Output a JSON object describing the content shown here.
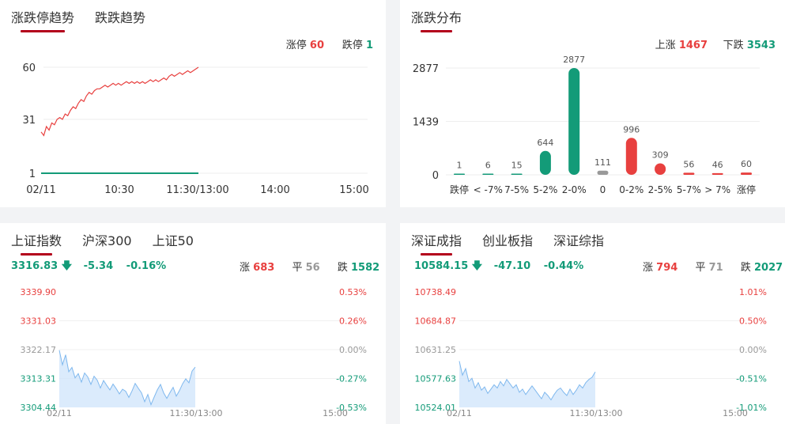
{
  "panel1": {
    "tabs": [
      "涨跌停趋势",
      "跌跌趋势"
    ],
    "limit_up_label": "涨停",
    "limit_up_value": "60",
    "limit_down_label": "跌停",
    "limit_down_value": "1"
  },
  "panel2": {
    "tabs": [
      "涨跌分布"
    ],
    "up_label": "上涨",
    "up_value": "1467",
    "down_label": "下跌",
    "down_value": "3543"
  },
  "panel3": {
    "tabs": [
      "上证指数",
      "沪深300",
      "上证50"
    ],
    "price": "3316.83",
    "change": "-5.34",
    "change_pct": "-0.16%",
    "up_label": "涨",
    "up_count": "683",
    "flat_label": "平",
    "flat_count": "56",
    "down_label": "跌",
    "down_count": "1582"
  },
  "panel4": {
    "tabs": [
      "深证成指",
      "创业板指",
      "深证综指"
    ],
    "price": "10584.15",
    "change": "-47.10",
    "change_pct": "-0.44%",
    "up_label": "涨",
    "up_count": "794",
    "flat_label": "平",
    "flat_count": "71",
    "down_label": "跌",
    "down_count": "2027"
  },
  "colors": {
    "up": "#e8403f",
    "down": "#139b78",
    "flat": "#999999",
    "accent": "#b3001b",
    "area": "#cfe4fb"
  },
  "chart_data": [
    {
      "type": "line",
      "ylim": [
        1,
        60
      ],
      "yticks": [
        "60",
        "31",
        "1"
      ],
      "xticks": [
        "02/11",
        "10:30",
        "11:30/13:00",
        "14:00",
        "15:00"
      ],
      "series": [
        {
          "color": "#e8403f",
          "values": [
            24,
            22,
            27,
            25,
            29,
            28,
            31,
            32,
            31,
            34,
            33,
            36,
            38,
            37,
            40,
            42,
            41,
            44,
            46,
            45,
            47,
            48,
            48,
            49,
            50,
            49,
            50,
            51,
            50,
            51,
            50,
            51,
            52,
            51,
            52,
            51,
            52,
            51,
            52,
            51,
            52,
            53,
            52,
            53,
            52,
            53,
            54,
            53,
            55,
            56,
            55,
            56,
            57,
            56,
            57,
            58,
            57,
            58,
            59,
            60
          ]
        },
        {
          "color": "#139b78",
          "values": [
            1,
            1,
            1,
            1,
            1,
            1,
            1,
            1,
            1,
            1,
            1,
            1,
            1,
            1,
            1,
            1,
            1,
            1,
            1,
            1,
            1,
            1,
            1,
            1,
            1,
            1,
            1,
            1,
            1,
            1,
            1,
            1,
            1,
            1,
            1,
            1,
            1,
            1,
            1,
            1,
            1,
            1,
            1,
            1,
            1,
            1,
            1,
            1,
            1,
            1,
            1,
            1,
            1,
            1,
            1,
            1,
            1,
            1,
            1,
            1
          ]
        }
      ]
    },
    {
      "type": "bar",
      "ylim": [
        0,
        2877
      ],
      "yticks": [
        "2877",
        "1439",
        "0"
      ],
      "categories": [
        "跌停",
        "< -7%",
        "7-5%",
        "5-2%",
        "2-0%",
        "0",
        "0-2%",
        "2-5%",
        "5-7%",
        "> 7%",
        "涨停"
      ],
      "values": [
        1,
        6,
        15,
        644,
        2877,
        111,
        996,
        309,
        56,
        46,
        60
      ],
      "value_labels": [
        "1",
        "6",
        "15",
        "644",
        "2877",
        "111",
        "996",
        "309",
        "56",
        "46",
        "60"
      ],
      "colors": [
        "#139b78",
        "#139b78",
        "#139b78",
        "#139b78",
        "#139b78",
        "#999999",
        "#e8403f",
        "#e8403f",
        "#e8403f",
        "#e8403f",
        "#e8403f"
      ]
    },
    {
      "type": "area",
      "ylim": [
        3304.44,
        3339.9
      ],
      "yticks_left": [
        "3339.90",
        "3331.03",
        "3322.17",
        "3313.31",
        "3304.44"
      ],
      "yticks_right": [
        "0.53%",
        "0.26%",
        "0.00%",
        "-0.27%",
        "-0.53%"
      ],
      "xticks": [
        "02/11",
        "11:30/13:00",
        "15:00"
      ],
      "values": [
        3322.0,
        3317.5,
        3320.6,
        3315.4,
        3316.7,
        3313.5,
        3314.8,
        3312.2,
        3315.0,
        3313.8,
        3311.5,
        3314.0,
        3312.8,
        3310.4,
        3312.7,
        3311.2,
        3309.8,
        3311.6,
        3310.2,
        3308.6,
        3310.0,
        3309.4,
        3307.5,
        3309.5,
        3311.8,
        3310.3,
        3308.9,
        3306.2,
        3308.4,
        3305.3,
        3307.6,
        3309.8,
        3311.5,
        3308.9,
        3307.2,
        3309.0,
        3310.6,
        3307.9,
        3309.6,
        3311.7,
        3313.2,
        3312.0,
        3315.6,
        3316.8
      ]
    },
    {
      "type": "area",
      "ylim": [
        10524.01,
        10738.49
      ],
      "yticks_left": [
        "10738.49",
        "10684.87",
        "10631.25",
        "10577.63",
        "10524.01"
      ],
      "yticks_right": [
        "1.01%",
        "0.50%",
        "0.00%",
        "-0.51%",
        "-1.01%"
      ],
      "xticks": [
        "02/11",
        "11:30/13:00",
        "15:00"
      ],
      "values": [
        10610,
        10584,
        10596,
        10572,
        10578,
        10560,
        10570,
        10556,
        10562,
        10550,
        10558,
        10566,
        10560,
        10572,
        10564,
        10576,
        10568,
        10560,
        10566,
        10552,
        10558,
        10548,
        10556,
        10564,
        10556,
        10548,
        10540,
        10552,
        10546,
        10538,
        10548,
        10556,
        10560,
        10552,
        10546,
        10558,
        10548,
        10556,
        10566,
        10560,
        10570,
        10576,
        10580,
        10590
      ]
    }
  ]
}
